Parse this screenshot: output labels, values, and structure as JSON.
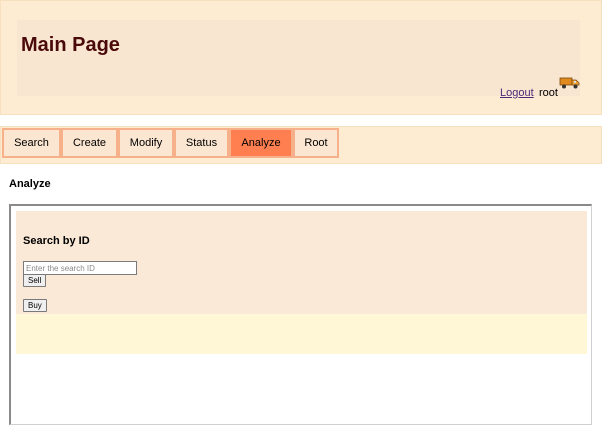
{
  "header": {
    "title": "Main Page",
    "logout_label": "Logout",
    "username": "root",
    "user_icon": "truck-icon"
  },
  "tabs": [
    {
      "label": "Search",
      "active": false
    },
    {
      "label": "Create",
      "active": false
    },
    {
      "label": "Modify",
      "active": false
    },
    {
      "label": "Status",
      "active": false
    },
    {
      "label": "Analyze",
      "active": true
    },
    {
      "label": "Root",
      "active": false
    }
  ],
  "main": {
    "section_title": "Analyze",
    "panel_title": "Search by ID",
    "search_placeholder": "Enter the search ID",
    "search_value": "",
    "sell_label": "Sell",
    "buy_label": "Buy"
  },
  "colors": {
    "header_bg": "#fdebd2",
    "title_color": "#4b0a0a",
    "active_tab": "#ff7f50",
    "tab_border": "#f6b08a",
    "panel_bg": "#f9e9d6",
    "panel_lower_bg": "#fff7d6"
  }
}
